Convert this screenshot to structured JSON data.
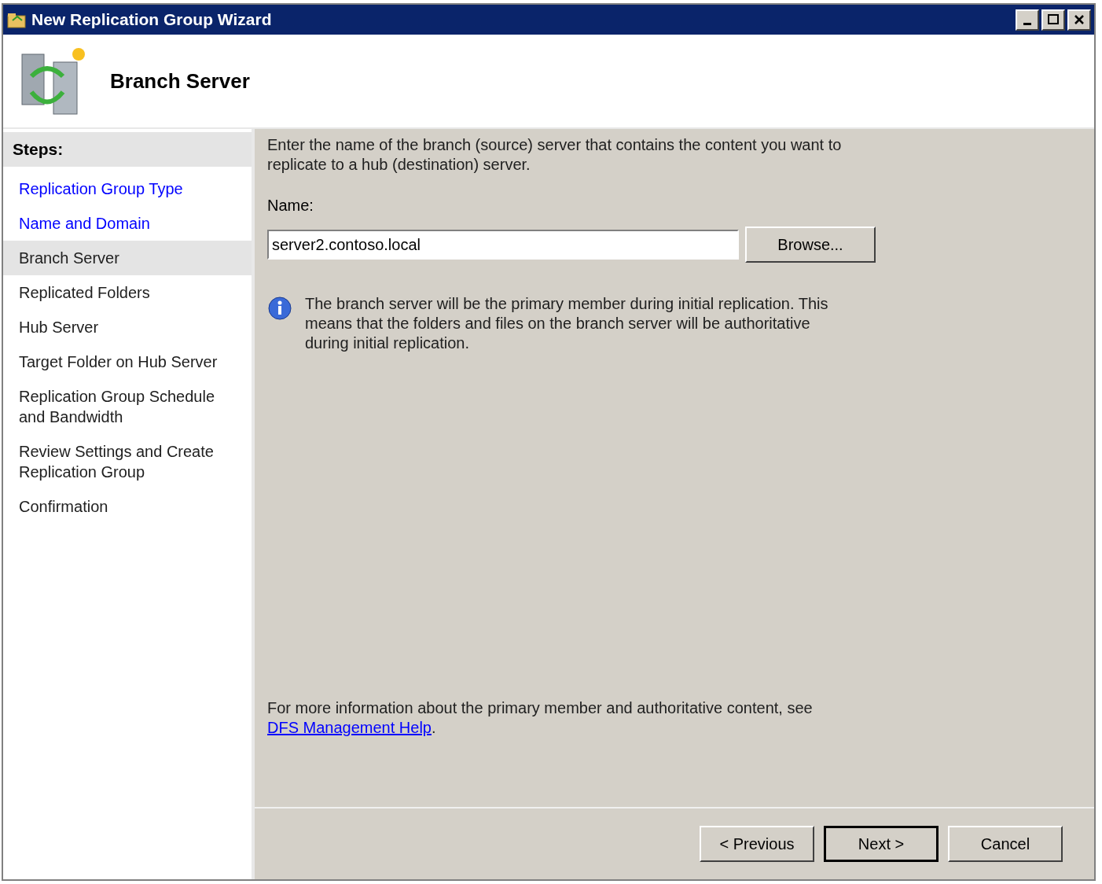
{
  "window": {
    "title": "New Replication Group Wizard"
  },
  "header": {
    "title": "Branch Server"
  },
  "steps": {
    "heading": "Steps:",
    "items": [
      {
        "label": "Replication Group Type",
        "completed": true,
        "selected": false
      },
      {
        "label": "Name and Domain",
        "completed": true,
        "selected": false
      },
      {
        "label": "Branch Server",
        "completed": false,
        "selected": true
      },
      {
        "label": "Replicated Folders",
        "completed": false,
        "selected": false
      },
      {
        "label": "Hub Server",
        "completed": false,
        "selected": false
      },
      {
        "label": "Target Folder on Hub Server",
        "completed": false,
        "selected": false
      },
      {
        "label": "Replication Group Schedule and Bandwidth",
        "completed": false,
        "selected": false
      },
      {
        "label": "Review Settings and Create Replication Group",
        "completed": false,
        "selected": false
      },
      {
        "label": "Confirmation",
        "completed": false,
        "selected": false
      }
    ]
  },
  "content": {
    "intro": "Enter the name of the branch (source) server that contains the content you want to replicate to a hub (destination) server.",
    "name_label": "Name:",
    "name_value": "server2.contoso.local",
    "browse_button": "Browse...",
    "info": "The branch server will be the primary member during initial replication. This means that the folders and files on the branch server will be authoritative during initial replication.",
    "more_info": "For more information about the primary member and authoritative content, see",
    "help_link": "DFS Management Help",
    "after_link": "."
  },
  "buttons": [
    {
      "label": "< Previous",
      "default": false
    },
    {
      "label": "Next >",
      "default": true
    },
    {
      "label": "Cancel",
      "default": false
    }
  ]
}
